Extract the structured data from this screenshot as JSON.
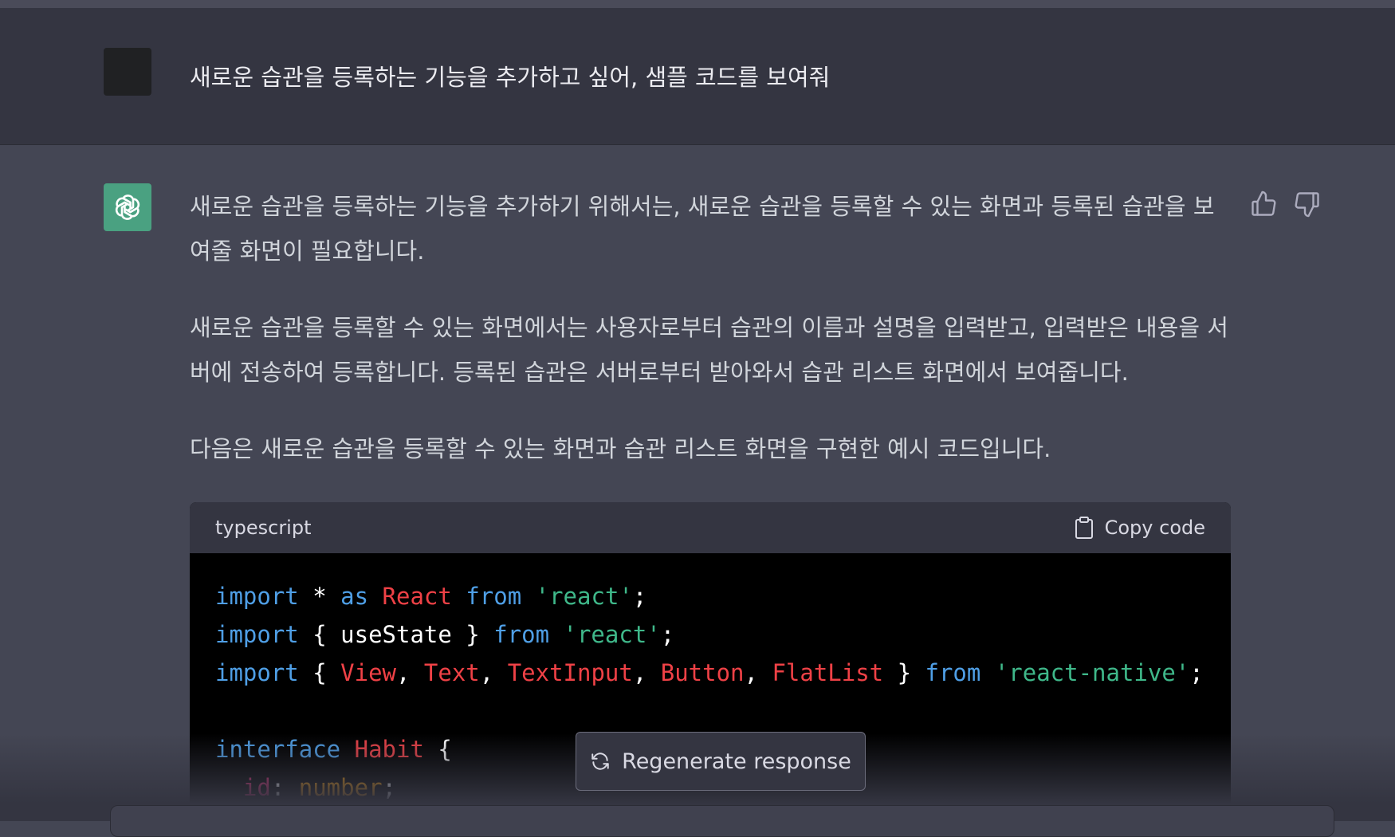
{
  "user": {
    "message": "새로운 습관을 등록하는 기능을 추가하고 싶어, 샘플 코드를 보여줘"
  },
  "assistant": {
    "paragraphs": [
      "새로운 습관을 등록하는 기능을 추가하기 위해서는, 새로운 습관을 등록할 수 있는 화면과 등록된 습관을 보여줄 화면이 필요합니다.",
      "새로운 습관을 등록할 수 있는 화면에서는 사용자로부터 습관의 이름과 설명을 입력받고, 입력받은 내용을 서버에 전송하여 등록합니다. 등록된 습관은 서버로부터 받아와서 습관 리스트 화면에서 보여줍니다.",
      "다음은 새로운 습관을 등록할 수 있는 화면과 습관 리스트 화면을 구현한 예시 코드입니다."
    ],
    "feedback_icons": [
      "thumbs-up-icon",
      "thumbs-down-icon"
    ]
  },
  "code_block": {
    "language": "typescript",
    "copy_label": "Copy code"
  },
  "regenerate_label": "Regenerate response",
  "colors": {
    "background": "#444654",
    "user_row": "#343541",
    "code_header": "#343541",
    "code_body": "#000000",
    "gpt_avatar": "#4aa181",
    "keyword": "#4f9fe6",
    "type": "#ef4146",
    "string": "#3fb88a",
    "number_type": "#e9950c",
    "property": "#df3079"
  }
}
